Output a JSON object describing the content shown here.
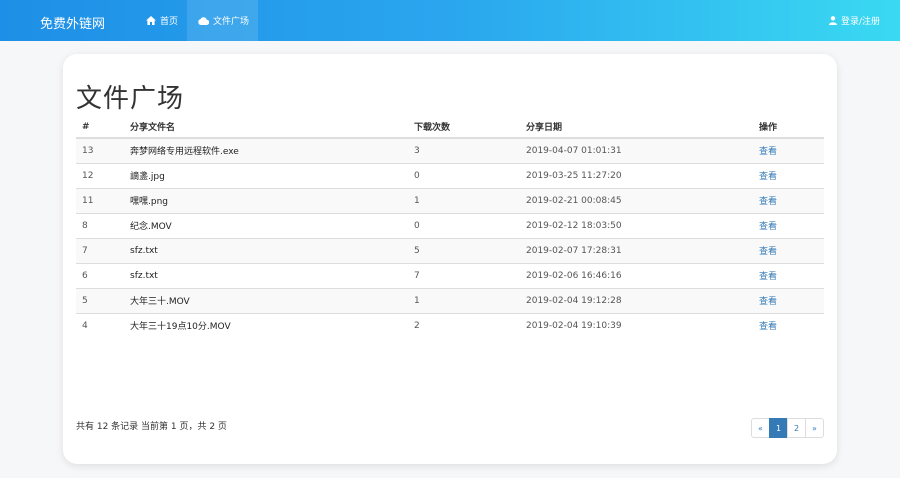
{
  "navbar": {
    "brand": "免费外链网",
    "home_label": "首页",
    "files_label": "文件广场",
    "login_label": "登录/注册"
  },
  "page": {
    "title": "文件广场"
  },
  "table": {
    "headers": [
      "#",
      "分享文件名",
      "下载次数",
      "分享日期",
      "操作"
    ],
    "rows": [
      {
        "id": "13",
        "name": "奔梦网络专用远程软件.exe",
        "downloads": "3",
        "date": "2019-04-07 01:01:31",
        "action": "查看"
      },
      {
        "id": "12",
        "name": "謫盞.jpg",
        "downloads": "0",
        "date": "2019-03-25 11:27:20",
        "action": "查看"
      },
      {
        "id": "11",
        "name": "嘿嘿.png",
        "downloads": "1",
        "date": "2019-02-21 00:08:45",
        "action": "查看"
      },
      {
        "id": "8",
        "name": "纪念.MOV",
        "downloads": "0",
        "date": "2019-02-12 18:03:50",
        "action": "查看"
      },
      {
        "id": "7",
        "name": "sfz.txt",
        "downloads": "5",
        "date": "2019-02-07 17:28:31",
        "action": "查看"
      },
      {
        "id": "6",
        "name": "sfz.txt",
        "downloads": "7",
        "date": "2019-02-06 16:46:16",
        "action": "查看"
      },
      {
        "id": "5",
        "name": "大年三十.MOV",
        "downloads": "1",
        "date": "2019-02-04 19:12:28",
        "action": "查看"
      },
      {
        "id": "4",
        "name": "大年三十19点10分.MOV",
        "downloads": "2",
        "date": "2019-02-04 19:10:39",
        "action": "查看"
      }
    ]
  },
  "footer": {
    "summary": "共有 12 条记录  当前第 1 页，共 2 页"
  },
  "pagination": {
    "prev": "«",
    "pages": [
      "1",
      "2"
    ],
    "active_page": "1",
    "next": "»"
  },
  "icons": {
    "home": "home-icon",
    "cloud": "cloud-icon",
    "user": "user-icon"
  },
  "colors": {
    "navbar_start": "#1e8fe6",
    "navbar_end": "#3ad9f2",
    "link": "#337ab7"
  }
}
